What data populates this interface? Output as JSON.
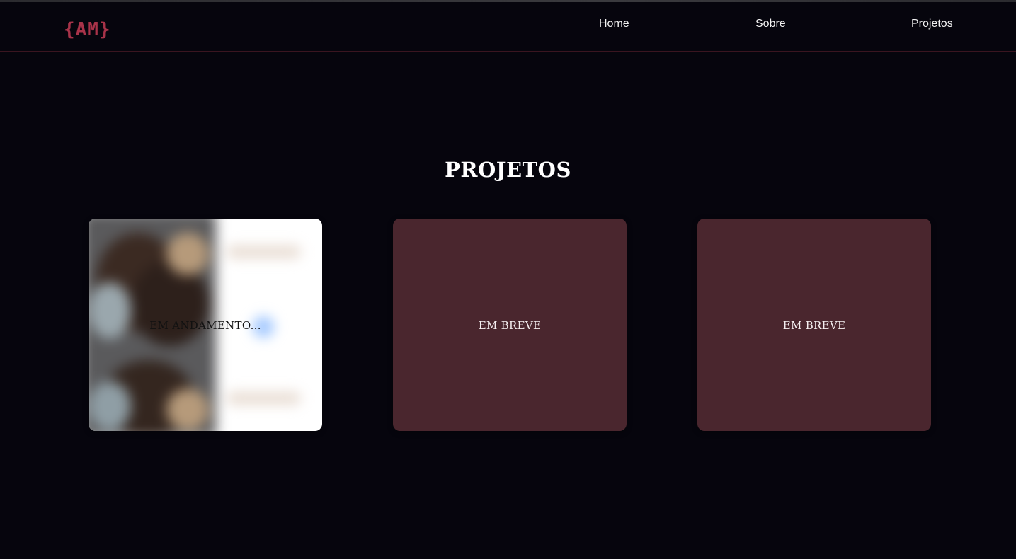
{
  "brand": {
    "logo_text": "{AM}",
    "accent": "#a83349"
  },
  "nav": {
    "items": [
      {
        "label": "Home"
      },
      {
        "label": "Sobre"
      },
      {
        "label": "Projetos"
      }
    ]
  },
  "projects": {
    "title": "PROJETOS",
    "cards": [
      {
        "label": "EM ANDAMENTO...",
        "background": "#ffffff",
        "has_preview": true
      },
      {
        "label": "EM BREVE",
        "background": "#4a262e"
      },
      {
        "label": "EM BREVE",
        "background": "#4a262e"
      }
    ]
  },
  "colors": {
    "page_background": "#06050d",
    "nav_border": "#3a1520",
    "text": "#ffffff"
  }
}
